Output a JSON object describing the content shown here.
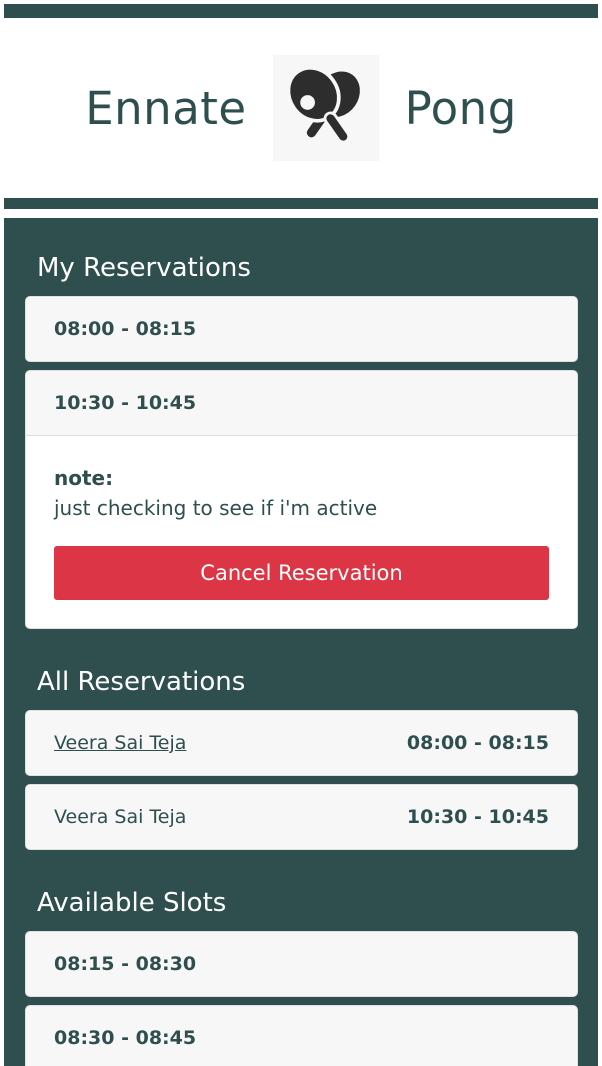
{
  "header": {
    "left_text": "Ennate",
    "right_text": "Pong",
    "logo_icon": "ping-pong-paddles-icon"
  },
  "my_reservations": {
    "title": "My Reservations",
    "items": [
      {
        "time": "08:00 - 08:15"
      },
      {
        "time": "10:30 - 10:45",
        "note_label": "note:",
        "note_text": "just checking to see if i'm active",
        "cancel_label": "Cancel Reservation"
      }
    ]
  },
  "all_reservations": {
    "title": "All Reservations",
    "items": [
      {
        "name": "Veera Sai Teja",
        "time": "08:00 - 08:15"
      },
      {
        "name": "Veera Sai Teja",
        "time": "10:30 - 10:45"
      }
    ]
  },
  "available_slots": {
    "title": "Available Slots",
    "items": [
      {
        "time": "08:15 - 08:30"
      },
      {
        "time": "08:30 - 08:45"
      }
    ]
  },
  "colors": {
    "primary_dark": "#2f4f4f",
    "danger": "#dc3545",
    "card_bg": "#f7f7f7"
  }
}
